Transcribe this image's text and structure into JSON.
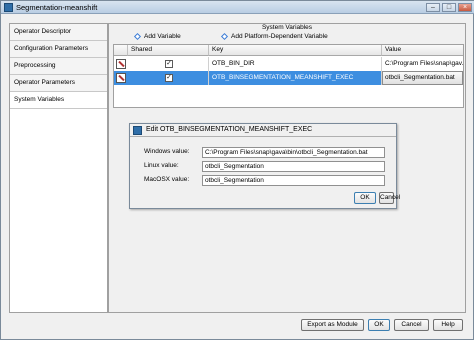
{
  "window": {
    "title": "Segmentation-meanshift"
  },
  "sidebar": {
    "items": [
      {
        "label": "Operator Descriptor"
      },
      {
        "label": "Configuration Parameters"
      },
      {
        "label": "Preprocessing"
      },
      {
        "label": "Operator Parameters"
      },
      {
        "label": "System Variables"
      }
    ]
  },
  "system_variables": {
    "section_title": "System Variables",
    "add_variable": "Add Variable",
    "add_platform_variable": "Add Platform-Dependent Variable",
    "columns": [
      "Shared",
      "Key",
      "Value"
    ],
    "rows": [
      {
        "shared_mark": "✓",
        "key": "OTB_BIN_DIR",
        "value": "C:\\Program Files\\snap\\gav..."
      },
      {
        "shared_mark": "✓",
        "key": "OTB_BINSEGMENTATION_MEANSHIFT_EXEC",
        "value": "otbcli_Segmentation.bat"
      }
    ]
  },
  "edit_dialog": {
    "title": "Edit OTB_BINSEGMENTATION_MEANSHIFT_EXEC",
    "windows_label": "Windows value:",
    "windows_value": "C:\\Program Files\\snap\\gava\\bin\\otbcli_Segmentation.bat",
    "linux_label": "Linux value:",
    "linux_value": "otbcli_Segmentation",
    "macosx_label": "MacOSX value:",
    "macosx_value": "otbcli_Segmentation",
    "ok_label": "OK",
    "cancel_label": "Cancel"
  },
  "footer": {
    "export_label": "Export as Module",
    "ok_label": "OK",
    "cancel_label": "Cancel",
    "help_label": "Help"
  }
}
